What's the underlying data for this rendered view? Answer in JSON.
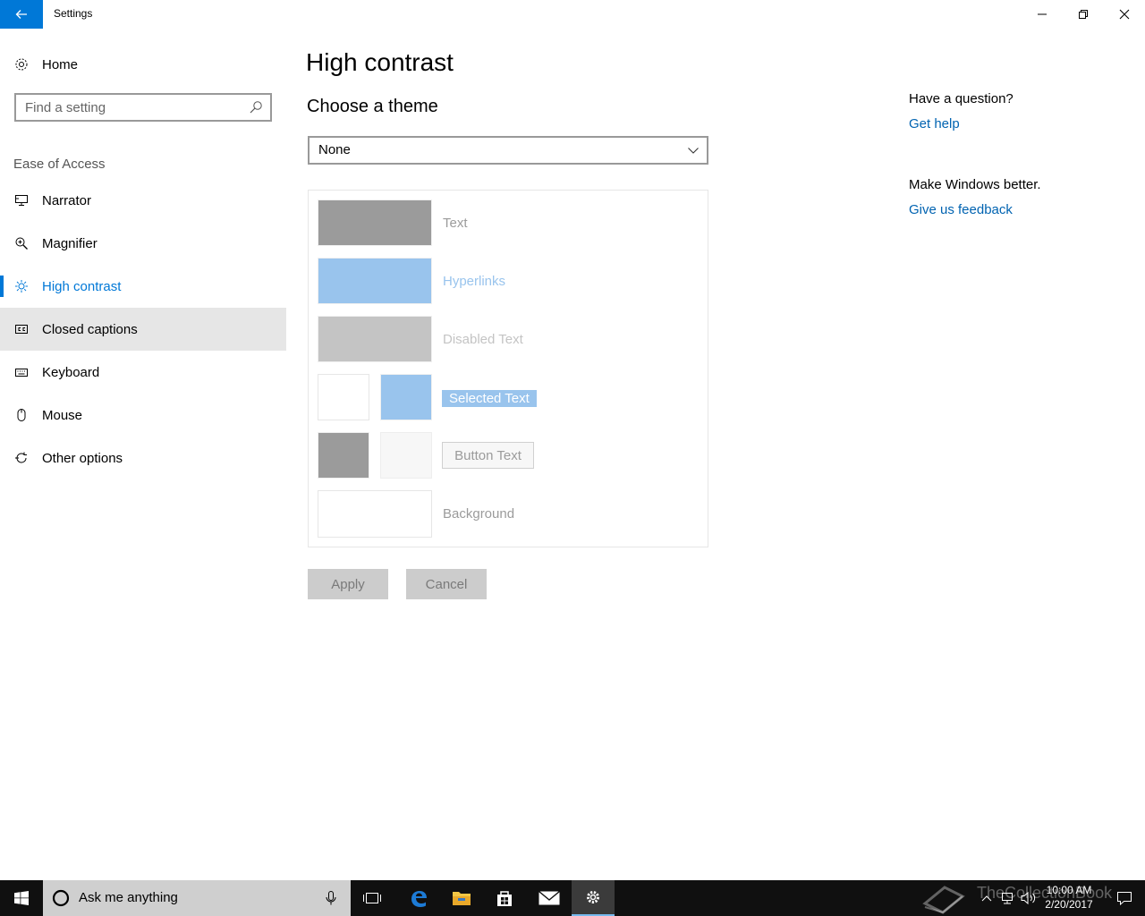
{
  "window": {
    "title": "Settings"
  },
  "sidebar": {
    "home_label": "Home",
    "search_placeholder": "Find a setting",
    "section_label": "Ease of Access",
    "items": [
      {
        "label": "Narrator",
        "icon": "narrator-icon"
      },
      {
        "label": "Magnifier",
        "icon": "magnifier-icon"
      },
      {
        "label": "High contrast",
        "icon": "high-contrast-icon",
        "selected": true
      },
      {
        "label": "Closed captions",
        "icon": "closed-captions-icon",
        "hover": true
      },
      {
        "label": "Keyboard",
        "icon": "keyboard-icon"
      },
      {
        "label": "Mouse",
        "icon": "mouse-icon"
      },
      {
        "label": "Other options",
        "icon": "other-options-icon"
      }
    ]
  },
  "main": {
    "page_title": "High contrast",
    "choose_theme_label": "Choose a theme",
    "theme_dropdown_value": "None",
    "preview": {
      "text_label": "Text",
      "hyperlinks_label": "Hyperlinks",
      "disabled_text_label": "Disabled Text",
      "selected_text_label": "Selected Text",
      "button_text_label": "Button Text",
      "background_label": "Background"
    },
    "colors": {
      "text": "#9b9b9b",
      "hyperlinks": "#99c4ed",
      "disabled_text": "#c4c4c4",
      "selected_bg": "#99c4ed",
      "button_face": "#9b9b9b",
      "button_bg": "#f7f7f7",
      "background": "#ffffff"
    },
    "apply_label": "Apply",
    "cancel_label": "Cancel"
  },
  "right_panel": {
    "question_heading": "Have a question?",
    "get_help_link": "Get help",
    "feedback_heading": "Make Windows better.",
    "feedback_link": "Give us feedback"
  },
  "taskbar": {
    "search_text": "Ask me anything",
    "time": "10:00 AM",
    "date": "2/20/2017",
    "watermark": "TheCollectionBook",
    "accent": "#0078d7"
  }
}
